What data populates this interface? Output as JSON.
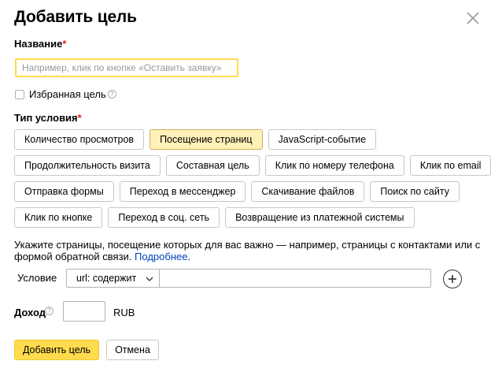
{
  "dialog": {
    "title": "Добавить цель",
    "close_icon": "close-icon"
  },
  "name_field": {
    "label": "Название",
    "required_mark": "*",
    "value": "",
    "placeholder": "Например, клик по кнопке «Оставить заявку»"
  },
  "favorite": {
    "label": "Избранная цель",
    "checked": false,
    "help_icon": "question-circle-icon",
    "help_glyph": "?"
  },
  "condition_type": {
    "label": "Тип условия",
    "required_mark": "*",
    "selected": "Посещение страниц",
    "rows": [
      [
        "Количество просмотров",
        "Посещение страниц",
        "JavaScript-событие"
      ],
      [
        "Продолжительность визита",
        "Составная цель",
        "Клик по номеру телефона",
        "Клик по email"
      ],
      [
        "Отправка формы",
        "Переход в мессенджер",
        "Скачивание файлов",
        "Поиск по сайту"
      ],
      [
        "Клик по кнопке",
        "Переход в соц. сеть",
        "Возвращение из платежной системы"
      ]
    ]
  },
  "hint": {
    "text": "Укажите страницы, посещение которых для вас важно — например, страницы с контактами или с формой обратной связи.",
    "link_text": "Подробнее",
    "tail": "."
  },
  "condition": {
    "label": "Условие",
    "select_value": "url: содержит",
    "input_value": "",
    "chevron_icon": "chevron-down-icon",
    "add_icon": "plus-icon"
  },
  "income": {
    "label": "Доход",
    "help_icon": "question-circle-icon",
    "help_glyph": "?",
    "value": "",
    "currency": "RUB"
  },
  "actions": {
    "submit_label": "Добавить цель",
    "cancel_label": "Отмена"
  },
  "colors": {
    "accent_yellow": "#ffdb4d",
    "active_chip": "#fff1b8",
    "link": "#0044bb",
    "required": "#ee2222"
  }
}
